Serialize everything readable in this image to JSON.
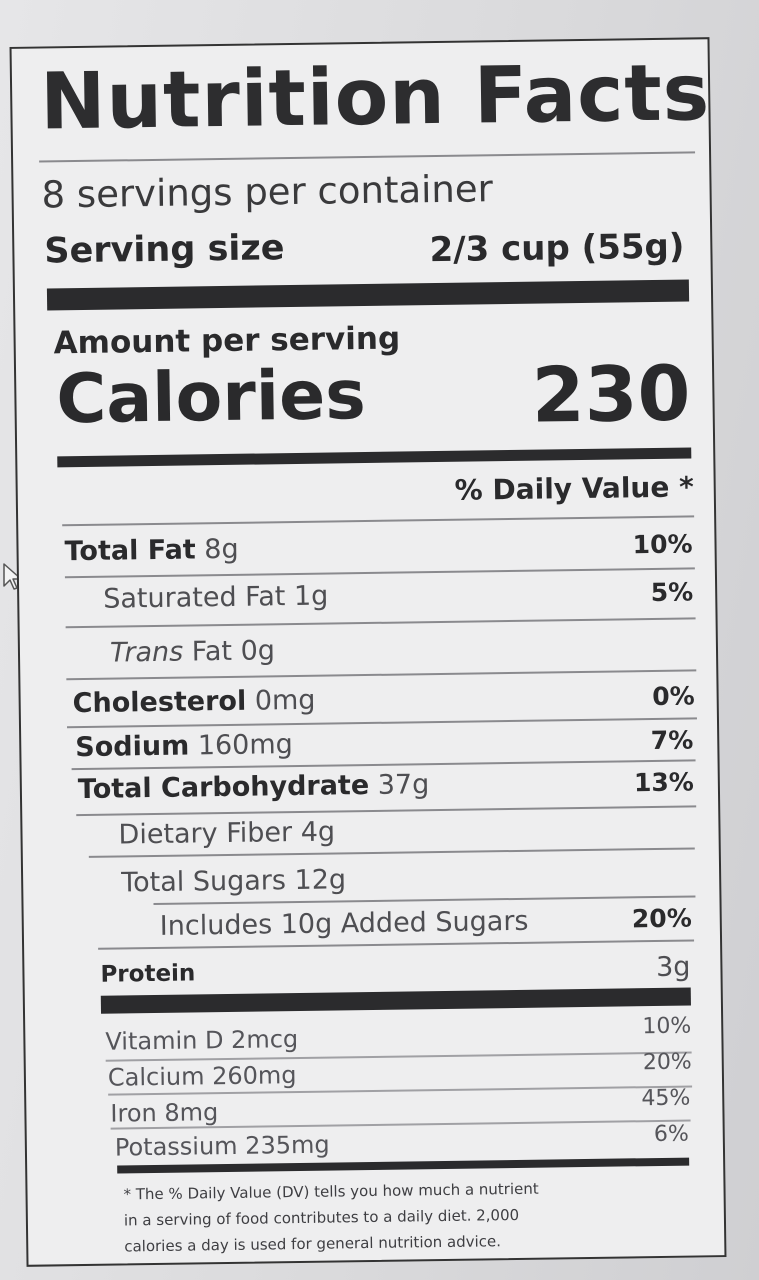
{
  "title": "Nutrition Facts",
  "servings_per_container": "8 servings per container",
  "serving_size_label": "Serving size",
  "serving_size_value": "2/3 cup (55g)",
  "amount_per_serving": "Amount per serving",
  "calories_label": "Calories",
  "calories_value": "230",
  "daily_value_header": "% Daily Value *",
  "nutrients": [
    {
      "name": "Total Fat",
      "amount": "8g",
      "dv": "10%"
    },
    {
      "name": "Saturated Fat",
      "amount": "1g",
      "dv": "5%"
    },
    {
      "name": "Trans",
      "amount": "Fat 0g",
      "dv": ""
    },
    {
      "name": "Cholesterol",
      "amount": "0mg",
      "dv": "0%"
    },
    {
      "name": "Sodium",
      "amount": "160mg",
      "dv": "7%"
    },
    {
      "name": "Total Carbohydrate",
      "amount": "37g",
      "dv": "13%"
    },
    {
      "name": "Dietary Fiber",
      "amount": "4g",
      "dv": ""
    },
    {
      "name": "Total Sugars",
      "amount": "12g",
      "dv": ""
    },
    {
      "name": "Includes 10g Added Sugars",
      "amount": "",
      "dv": "20%"
    },
    {
      "name": "Protein",
      "amount": "",
      "dv": "3g"
    }
  ],
  "vitamins": [
    {
      "name": "Vitamin D 2mcg",
      "dv": "10%"
    },
    {
      "name": "Calcium 260mg",
      "dv": "20%"
    },
    {
      "name": "Iron 8mg",
      "dv": "45%"
    },
    {
      "name": "Potassium 235mg",
      "dv": "6%"
    }
  ],
  "footnote": [
    "* The % Daily Value (DV) tells you how much a nutrient",
    "in a serving of food contributes to a daily diet. 2,000",
    "calories a day is used for general nutrition advice."
  ],
  "icons": {
    "cursor": "mouse-pointer-icon"
  }
}
